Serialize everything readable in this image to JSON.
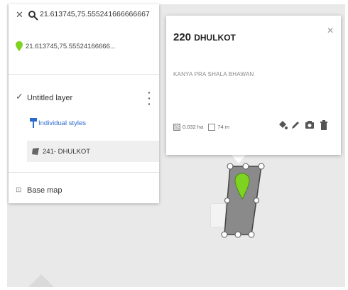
{
  "search": {
    "query": "21.613745,75.555241666666667"
  },
  "result": {
    "label": "21.613745,75.55524166666..."
  },
  "layer": {
    "title": "Untitled layer",
    "styles_link": "Individual styles",
    "feature_label": "241- DHULKOT"
  },
  "basemap": {
    "label": "Base map"
  },
  "card": {
    "title_number": "220",
    "title_name": "DHULKOT",
    "description": "KANYA PRA SHALA BHAWAN",
    "area": "0.032 ha",
    "perimeter": "74 m"
  },
  "colors": {
    "accent_link": "#2a6ad0",
    "pin": "#7ed321",
    "polygon_fill": "#8a8a8a"
  },
  "icons": [
    "close-icon",
    "search-icon",
    "pin-icon",
    "checkbox-icon",
    "more-vert-icon",
    "paint-icon",
    "polygon-icon",
    "expand-icon",
    "paint-bucket-icon",
    "pencil-icon",
    "camera-icon",
    "trash-icon",
    "area-icon",
    "ruler-icon"
  ]
}
